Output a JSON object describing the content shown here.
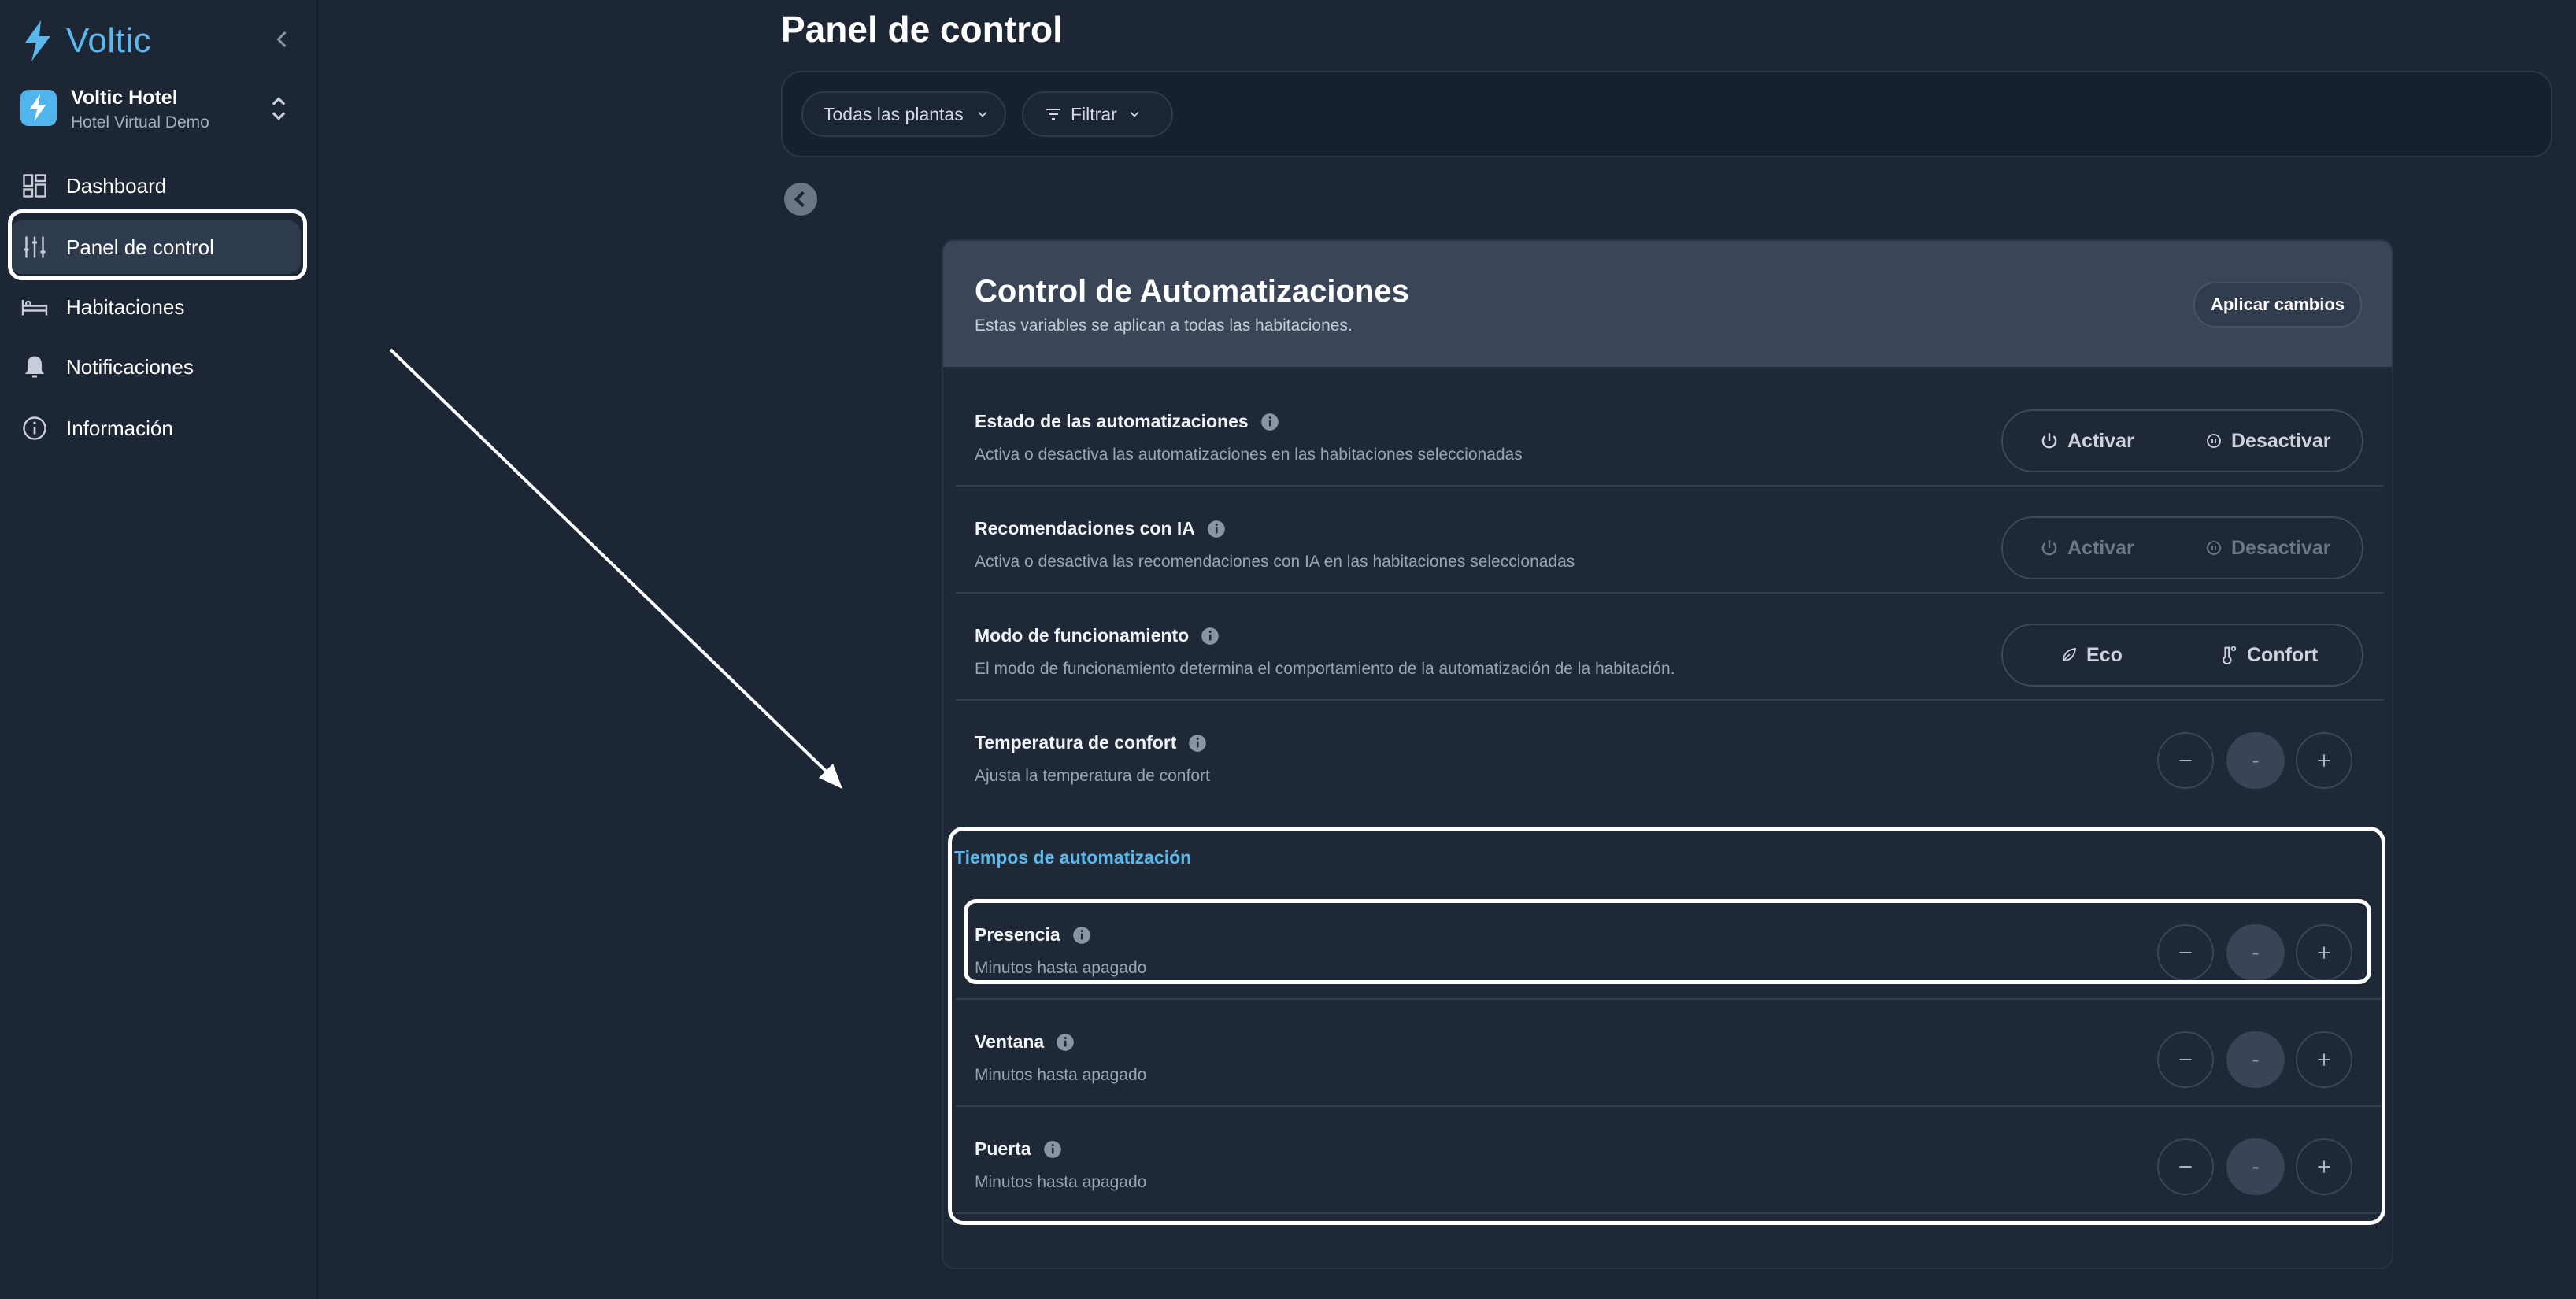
{
  "app": {
    "logo_text": "Voltic",
    "brand_color": "#5bb8ec"
  },
  "hotel": {
    "name": "Voltic Hotel",
    "subtitle": "Hotel Virtual Demo"
  },
  "sidebar": {
    "items": [
      {
        "label": "Dashboard",
        "icon": "grid-icon"
      },
      {
        "label": "Panel de control",
        "icon": "sliders-icon",
        "active": true
      },
      {
        "label": "Habitaciones",
        "icon": "bed-icon"
      },
      {
        "label": "Notificaciones",
        "icon": "bell-icon"
      },
      {
        "label": "Información",
        "icon": "info-icon"
      }
    ]
  },
  "page": {
    "title": "Panel de control"
  },
  "filters": {
    "floors_label": "Todas las plantas",
    "filter_label": "Filtrar"
  },
  "card": {
    "title": "Control de Automatizaciones",
    "subtitle": "Estas variables se aplican a todas las habitaciones.",
    "apply_label": "Aplicar cambios",
    "rows": [
      {
        "title": "Estado de las automatizaciones",
        "desc": "Activa o desactiva las automatizaciones en las habitaciones seleccionadas",
        "opt1": "Activar",
        "opt2": "Desactivar"
      },
      {
        "title": "Recomendaciones con IA",
        "desc": "Activa o desactiva las recomendaciones con IA en las habitaciones seleccionadas",
        "opt1": "Activar",
        "opt2": "Desactivar"
      },
      {
        "title": "Modo de funcionamiento",
        "desc": "El modo de funcionamiento determina el comportamiento de la automatización de la habitación.",
        "opt1": "Eco",
        "opt2": "Confort"
      },
      {
        "title": "Temperatura de confort",
        "desc": "Ajusta la temperatura de confort",
        "value": "-"
      }
    ],
    "section_title": "Tiempos de automatización",
    "timers": [
      {
        "title": "Presencia",
        "desc": "Minutos hasta apagado",
        "value": "-"
      },
      {
        "title": "Ventana",
        "desc": "Minutos hasta apagado",
        "value": "-"
      },
      {
        "title": "Puerta",
        "desc": "Minutos hasta apagado",
        "value": "-"
      }
    ]
  }
}
